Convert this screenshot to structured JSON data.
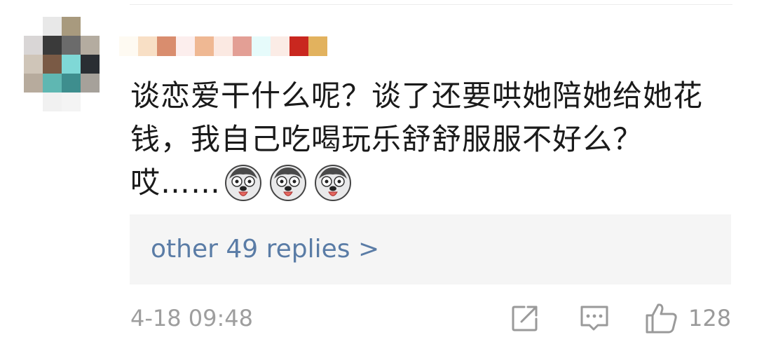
{
  "comment": {
    "line1": "谈恋爱干什么呢？谈了还要哄她陪她给她花",
    "line2": "钱，我自己吃喝玩乐舒舒服服不好么？",
    "line3": "哎……"
  },
  "emoji": {
    "icon": "husky-dog-emoji",
    "count": 3
  },
  "replies": {
    "label": "other 49 replies >"
  },
  "meta": {
    "timestamp": "4-18 09:48"
  },
  "actions": {
    "like_count": "128",
    "share_icon": "share-icon",
    "reply_icon": "comment-icon",
    "like_icon": "thumbs-up-icon"
  },
  "colors": {
    "link": "#5a7ca6",
    "reply_box_bg": "#f5f5f5",
    "meta_text": "#9e9e9e",
    "body_text": "#1a1a1a"
  }
}
